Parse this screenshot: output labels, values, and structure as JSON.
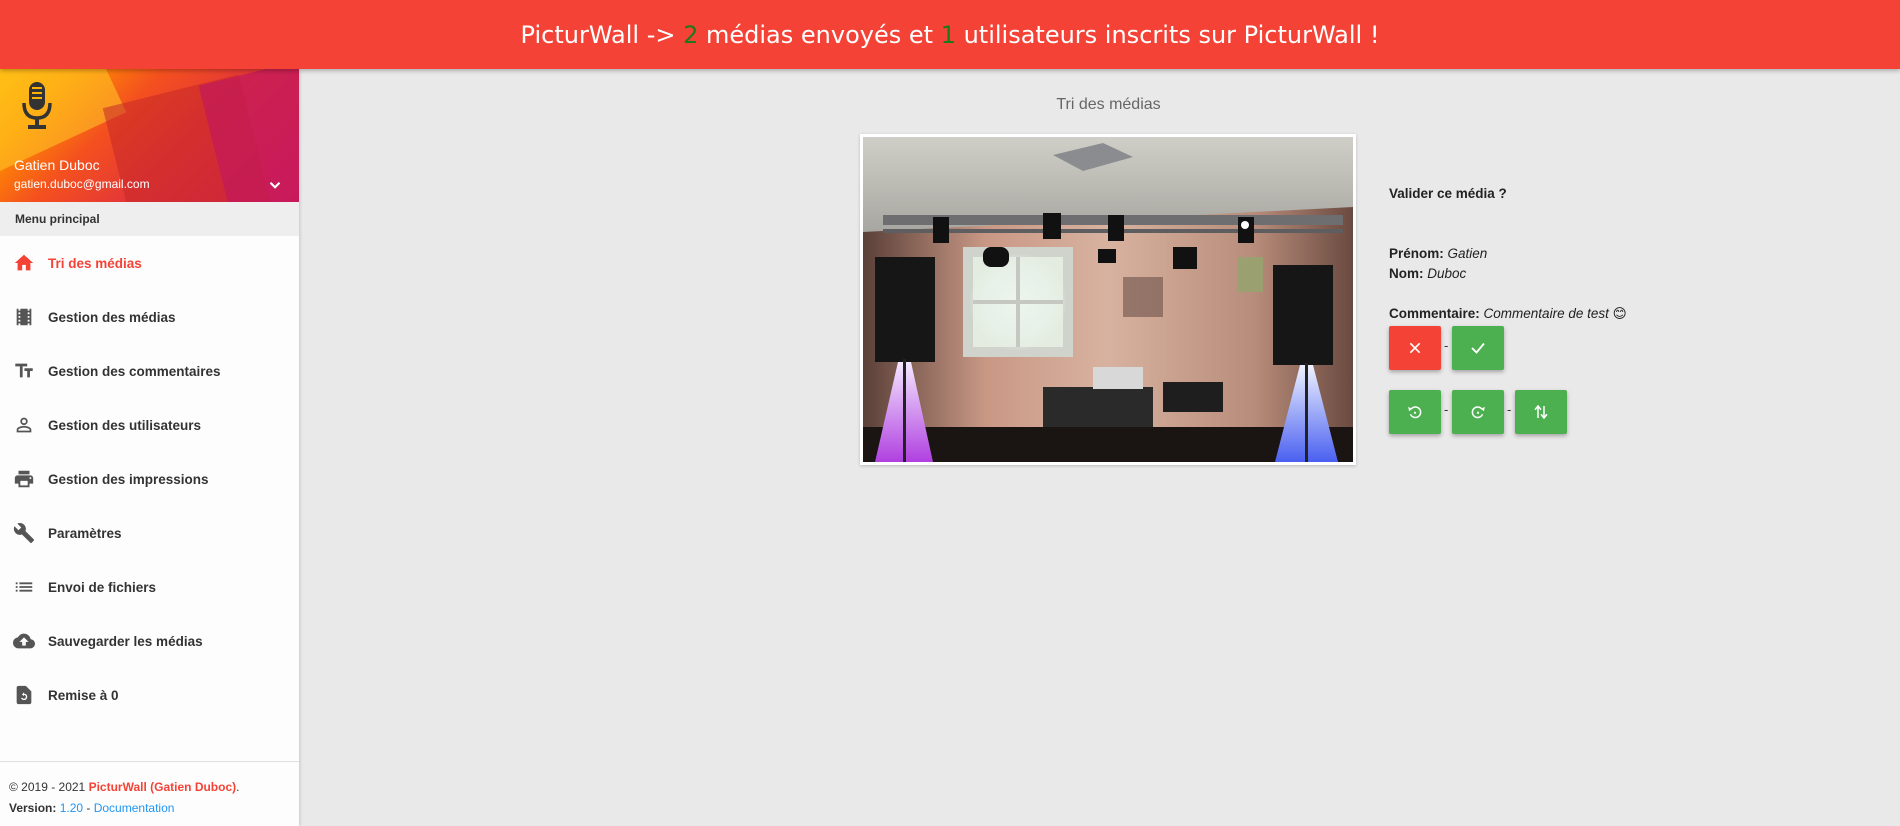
{
  "banner": {
    "prefix": "PicturWall -> ",
    "media_count": "2",
    "middle": " médias envoyés et ",
    "user_count": "1",
    "suffix": " utilisateurs inscrits sur PicturWall !"
  },
  "profile": {
    "name": "Gatien Duboc",
    "email": "gatien.duboc@gmail.com"
  },
  "sidebar": {
    "header": "Menu principal",
    "items": [
      {
        "label": "Tri des médias",
        "icon": "home-icon",
        "active": true
      },
      {
        "label": "Gestion des médias",
        "icon": "film-icon"
      },
      {
        "label": "Gestion des commentaires",
        "icon": "text-format-icon"
      },
      {
        "label": "Gestion des utilisateurs",
        "icon": "person-icon"
      },
      {
        "label": "Gestion des impressions",
        "icon": "printer-icon"
      },
      {
        "label": "Paramètres",
        "icon": "wrench-icon"
      },
      {
        "label": "Envoi de fichiers",
        "icon": "list-icon"
      },
      {
        "label": "Sauvegarder les médias",
        "icon": "cloud-upload-icon"
      },
      {
        "label": "Remise à 0",
        "icon": "file-restore-icon"
      }
    ]
  },
  "footer": {
    "copyright": "© 2019 - 2021 ",
    "brand": "PicturWall (Gatien Duboc)",
    "period": ".",
    "version_label": "Version: ",
    "version": "1.20",
    "dash": " - ",
    "doc_link": "Documentation"
  },
  "main": {
    "title": "Tri des médias",
    "question": "Valider ce média ?",
    "firstname_label": "Prénom:",
    "firstname": "Gatien",
    "lastname_label": "Nom:",
    "lastname": "Duboc",
    "comment_label": "Commentaire:",
    "comment": "Commentaire de test 😊",
    "separator": "-"
  },
  "colors": {
    "accent": "#f44336",
    "success": "#4caf50",
    "count_green": "#1b7a1b",
    "link": "#2196f3"
  }
}
